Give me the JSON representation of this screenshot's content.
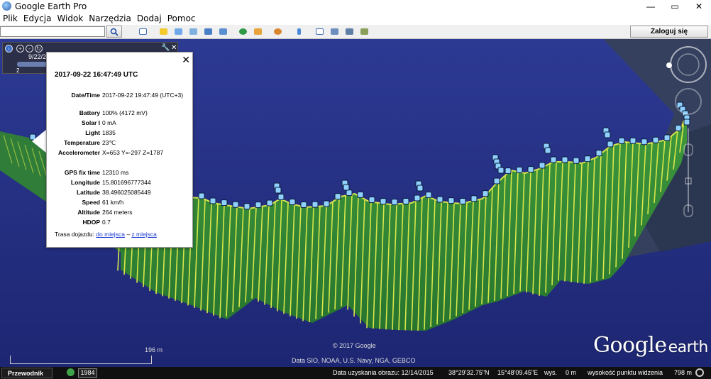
{
  "window": {
    "title": "Google Earth Pro",
    "minimize": "—",
    "maximize": "▭",
    "close": "✕"
  },
  "menu": [
    "Plik",
    "Edycja",
    "Widok",
    "Narzędzia",
    "Dodaj",
    "Pomoc"
  ],
  "toolbar": {
    "search_value": "",
    "signin_label": "Zaloguj się"
  },
  "timeslider": {
    "date": "9/22/2",
    "value": "2"
  },
  "balloon": {
    "title": "2017-09-22 16:47:49 UTC",
    "rows": [
      {
        "label": "Date/Time",
        "value": "2017-09-22 19:47:49 (UTC+3)"
      },
      {
        "label": "Battery",
        "value": "100% (4172 mV)"
      },
      {
        "label": "Solar I",
        "value": "0 mA"
      },
      {
        "label": "Light",
        "value": "1835"
      },
      {
        "label": "Temperature",
        "value": "23℃"
      },
      {
        "label": "Accelerometer",
        "value": "X=653 Y=-297 Z=1787"
      },
      {
        "label": "GPS fix time",
        "value": "12310 ms"
      },
      {
        "label": "Longitude",
        "value": "15.801696777344"
      },
      {
        "label": "Latitude",
        "value": "38.496025085449"
      },
      {
        "label": "Speed",
        "value": "61 km/h"
      },
      {
        "label": "Altitude",
        "value": "264 meters"
      },
      {
        "label": "HDOP",
        "value": "0.7"
      }
    ],
    "route_label": "Trasa dojazdu:",
    "route_to": "do miejsca",
    "route_sep": "–",
    "route_from": "z miejsca"
  },
  "map": {
    "copyright": "© 2017 Google",
    "data_sources": "Data SIO, NOAA, U.S. Navy, NGA, GEBCO",
    "scale_label": "196 m",
    "logo_main": "Google",
    "logo_sub": "earth"
  },
  "statusbar": {
    "guide": "Przewodnik",
    "year": "1984",
    "imagery_date": "Data uzyskania obrazu: 12/14/2015",
    "lat": "38°29'32.75\"N",
    "lon": "15°48'09.45\"E",
    "elev_label": "wys.",
    "elev": "0 m",
    "eye_label": "wysokość punktu widzenia",
    "eye": "798 m"
  },
  "colors": {
    "sea": "#2a3590",
    "wall": "#2f8a34",
    "wall_line": "#d8e64a",
    "track_point": "#8fd0ff"
  }
}
